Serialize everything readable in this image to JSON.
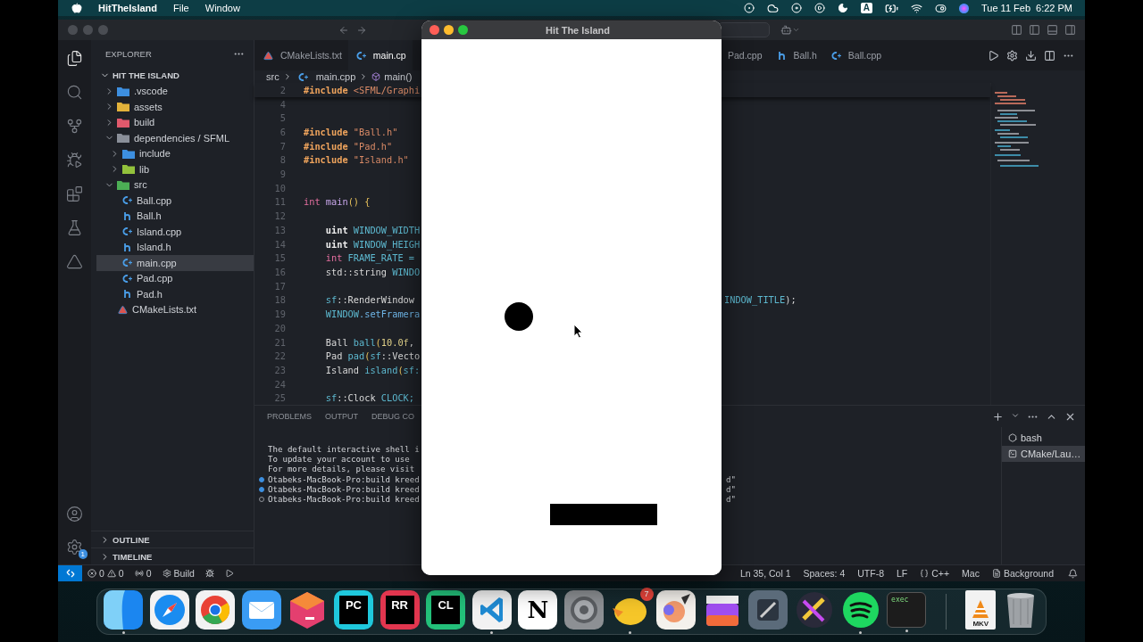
{
  "menubar": {
    "app": "HitTheIsland",
    "menus": [
      "File",
      "Window"
    ],
    "input_source": "A",
    "date": "Tue 11 Feb",
    "time": "6:22 PM"
  },
  "vscode": {
    "activity_bar": [
      {
        "kind": "explorer",
        "selected": true
      },
      {
        "kind": "search",
        "selected": false
      },
      {
        "kind": "source-control",
        "selected": false
      },
      {
        "kind": "run-debug",
        "selected": false
      },
      {
        "kind": "extensions",
        "selected": false
      },
      {
        "kind": "testing",
        "selected": false
      },
      {
        "kind": "cmake",
        "selected": false
      }
    ],
    "manage_badge": "1",
    "sidebar": {
      "title": "EXPLORER",
      "section": "HIT THE ISLAND",
      "tree": [
        {
          "name": ".vscode",
          "kind": "folder",
          "color": "#3d8fe0",
          "expanded": false
        },
        {
          "name": "assets",
          "kind": "folder",
          "color": "#e2b23a",
          "expanded": false
        },
        {
          "name": "build",
          "kind": "folder",
          "color": "#e0596c",
          "expanded": false
        },
        {
          "name": "dependencies / SFML",
          "kind": "folder",
          "color": "#8a8f99",
          "expanded": true,
          "children": [
            {
              "name": "include",
              "kind": "folder",
              "color": "#3d8fe0",
              "expanded": false
            },
            {
              "name": "lib",
              "kind": "folder",
              "color": "#93c23c",
              "expanded": false
            }
          ]
        },
        {
          "name": "src",
          "kind": "folder",
          "color": "#4cae55",
          "expanded": true,
          "children": [
            {
              "name": "Ball.cpp",
              "kind": "cpp",
              "selected": false
            },
            {
              "name": "Ball.h",
              "kind": "header",
              "selected": false
            },
            {
              "name": "Island.cpp",
              "kind": "cpp",
              "selected": false
            },
            {
              "name": "Island.h",
              "kind": "header",
              "selected": false
            },
            {
              "name": "main.cpp",
              "kind": "cpp",
              "selected": true
            },
            {
              "name": "Pad.cpp",
              "kind": "cpp",
              "selected": false
            },
            {
              "name": "Pad.h",
              "kind": "header",
              "selected": false
            }
          ]
        },
        {
          "name": "CMakeLists.txt",
          "kind": "cmake",
          "selected": false
        }
      ],
      "bottom_sections": [
        "OUTLINE",
        "TIMELINE"
      ]
    },
    "tabs": {
      "left_of_game_window": [
        {
          "label": "CMakeLists.txt",
          "kind": "cmake",
          "selected": false
        },
        {
          "label": "main.cp",
          "kind": "cpp",
          "selected": true
        }
      ],
      "right_of_game_window": [
        {
          "label": "Pad.cpp",
          "selected": false
        },
        {
          "label": "Ball.h",
          "kind": "header",
          "selected": false
        },
        {
          "label": "Ball.cpp",
          "kind": "cpp",
          "selected": false
        }
      ]
    },
    "breadcrumb": [
      "src",
      "main.cpp",
      "main()"
    ],
    "sticky_line": {
      "number": "2",
      "tokens": [
        {
          "text": "#include ",
          "kind": "dir"
        },
        {
          "text": "<SFML/Graphi",
          "kind": "str"
        }
      ]
    },
    "code_lines": [
      {
        "number": "4"
      },
      {
        "number": "5"
      },
      {
        "number": "6",
        "tokens": [
          {
            "text": "#include ",
            "kind": "dir"
          },
          {
            "text": "\"Ball.h\"",
            "kind": "str"
          }
        ]
      },
      {
        "number": "7",
        "tokens": [
          {
            "text": "#include ",
            "kind": "dir"
          },
          {
            "text": "\"Pad.h\"",
            "kind": "str"
          }
        ]
      },
      {
        "number": "8",
        "tokens": [
          {
            "text": "#include ",
            "kind": "dir"
          },
          {
            "text": "\"Island.h\"",
            "kind": "str"
          }
        ]
      },
      {
        "number": "9"
      },
      {
        "number": "10"
      },
      {
        "number": "11",
        "tokens": [
          {
            "text": "int ",
            "kind": "kw"
          },
          {
            "text": "main",
            "kind": "fn"
          },
          {
            "text": "() {",
            "kind": "punc"
          }
        ]
      },
      {
        "number": "12"
      },
      {
        "number": "13",
        "tokens": [
          {
            "text": "    uint ",
            "kind": "type"
          },
          {
            "text": "WINDOW_WIDTH",
            "kind": "id"
          }
        ]
      },
      {
        "number": "14",
        "tokens": [
          {
            "text": "    uint ",
            "kind": "type"
          },
          {
            "text": "WINDOW_HEIGH",
            "kind": "id"
          }
        ]
      },
      {
        "number": "15",
        "tokens": [
          {
            "text": "    int ",
            "kind": "kw"
          },
          {
            "text": "FRAME_RATE =",
            "kind": "id"
          }
        ]
      },
      {
        "number": "16",
        "tokens": [
          {
            "text": "    std::string ",
            "kind": "plain"
          },
          {
            "text": "WINDO",
            "kind": "id"
          }
        ]
      },
      {
        "number": "17"
      },
      {
        "number": "18",
        "tokens": [
          {
            "text": "    sf",
            "kind": "id"
          },
          {
            "text": "::RenderWindow",
            "kind": "plain"
          }
        ],
        "right_tokens": [
          {
            "text": "INDOW_TITLE",
            "kind": "id"
          },
          {
            "text": ");",
            "kind": "plain"
          }
        ]
      },
      {
        "number": "19",
        "tokens": [
          {
            "text": "    WINDOW",
            "kind": "id"
          },
          {
            "text": ".setFramera",
            "kind": "method"
          }
        ]
      },
      {
        "number": "20"
      },
      {
        "number": "21",
        "tokens": [
          {
            "text": "    Ball ",
            "kind": "plain"
          },
          {
            "text": "ball",
            "kind": "id"
          },
          {
            "text": "(",
            "kind": "punc"
          },
          {
            "text": "10.0f",
            "kind": "num"
          },
          {
            "text": ",",
            "kind": "plain"
          }
        ]
      },
      {
        "number": "22",
        "tokens": [
          {
            "text": "    Pad ",
            "kind": "plain"
          },
          {
            "text": "pad",
            "kind": "id"
          },
          {
            "text": "(",
            "kind": "punc"
          },
          {
            "text": "sf",
            "kind": "id"
          },
          {
            "text": "::Vecto",
            "kind": "plain"
          }
        ]
      },
      {
        "number": "23",
        "tokens": [
          {
            "text": "    Island ",
            "kind": "plain"
          },
          {
            "text": "island",
            "kind": "id"
          },
          {
            "text": "(",
            "kind": "punc"
          },
          {
            "text": "sf:",
            "kind": "id"
          }
        ]
      },
      {
        "number": "24"
      },
      {
        "number": "25",
        "tokens": [
          {
            "text": "    sf",
            "kind": "id"
          },
          {
            "text": "::Clock ",
            "kind": "plain"
          },
          {
            "text": "CLOCK;",
            "kind": "id"
          }
        ]
      }
    ],
    "panel": {
      "tabs": [
        "PROBLEMS",
        "OUTPUT",
        "DEBUG CO"
      ],
      "terminal_lines": [
        {
          "kind": "output",
          "text": "The default interactive shell i"
        },
        {
          "kind": "output",
          "text": "To update your account to use"
        },
        {
          "kind": "output",
          "text": "For more details, please visit"
        },
        {
          "kind": "success",
          "text": "Otabeks-MacBook-Pro:build kreed",
          "right": "d\""
        },
        {
          "kind": "success",
          "text": "Otabeks-MacBook-Pro:build kreed",
          "right": "d\""
        },
        {
          "kind": "pending",
          "text": "Otabeks-MacBook-Pro:build kreed",
          "right": "d\""
        }
      ],
      "terminals": [
        {
          "label": "bash",
          "kind": "shell",
          "selected": false
        },
        {
          "label": "CMake/Lau…",
          "kind": "task",
          "selected": true
        }
      ]
    },
    "status_bar": {
      "errors": "0",
      "warnings": "0",
      "ports": "0",
      "build": "Build",
      "position": "Ln 35, Col 1",
      "indent": "Spaces: 4",
      "encoding": "UTF-8",
      "eol": "LF",
      "language": "C++",
      "platform": "Mac",
      "background": "Background"
    }
  },
  "game_window": {
    "title": "Hit The Island"
  },
  "dock": {
    "apps": [
      {
        "kind": "finder",
        "running": true
      },
      {
        "kind": "safari",
        "running": false
      },
      {
        "kind": "chrome",
        "running": false
      },
      {
        "kind": "mail",
        "running": false
      },
      {
        "kind": "toolbox",
        "running": false
      },
      {
        "kind": "tile",
        "label": "PC",
        "color": "#1fc8dc",
        "running": false
      },
      {
        "kind": "tile",
        "label": "RR",
        "color": "#e2364f",
        "running": false
      },
      {
        "kind": "tile",
        "label": "CL",
        "color": "#23c07a",
        "running": false
      },
      {
        "kind": "vscode",
        "running": true
      },
      {
        "kind": "notion",
        "label": "N",
        "running": false
      },
      {
        "kind": "settings",
        "running": false
      },
      {
        "kind": "mascot",
        "badge": "7",
        "running": true
      },
      {
        "kind": "pixelmator",
        "running": false
      },
      {
        "kind": "finalcut",
        "running": false
      },
      {
        "kind": "compressor",
        "running": false
      },
      {
        "kind": "motion",
        "running": false
      },
      {
        "kind": "spotify",
        "running": true
      },
      {
        "kind": "terminal",
        "label": "exec",
        "running": true
      }
    ],
    "files": [
      {
        "kind": "video",
        "label": "MKV"
      },
      {
        "kind": "trash"
      }
    ]
  }
}
